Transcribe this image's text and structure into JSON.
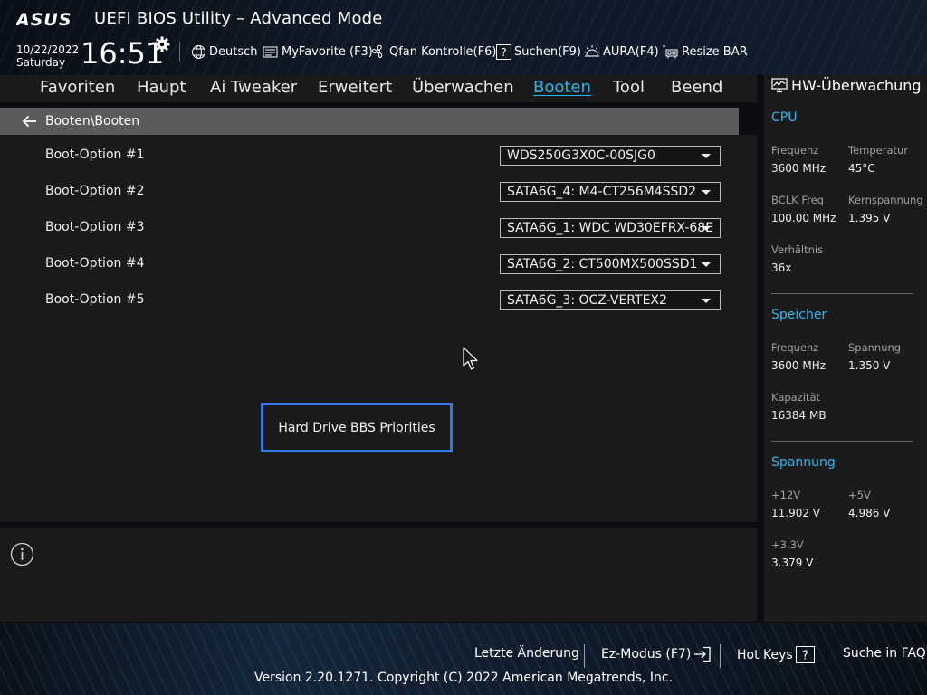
{
  "header": {
    "brand": "ASUS",
    "title": "UEFI BIOS Utility – Advanced Mode",
    "date": "10/22/2022",
    "day": "Saturday",
    "time": "16:51",
    "toolbar": [
      {
        "icon": "globe-icon",
        "label": "Deutsch"
      },
      {
        "icon": "myfavorite-icon",
        "label": "MyFavorite (F3)"
      },
      {
        "icon": "fan-icon",
        "label": "Qfan Kontrolle(F6)"
      },
      {
        "icon": "question-box-icon",
        "label": "Suchen(F9)"
      },
      {
        "icon": "aura-icon",
        "label": "AURA(F4)"
      },
      {
        "icon": "resize-bar-icon",
        "label": "Resize BAR"
      }
    ]
  },
  "nav": {
    "tabs": [
      "Favoriten",
      "Haupt",
      "Ai Tweaker",
      "Erweitert",
      "Überwachen",
      "Booten",
      "Tool",
      "Beend"
    ],
    "active": "Booten"
  },
  "breadcrumb": "Booten\\Booten",
  "boot_options": [
    {
      "label": "Boot-Option #1",
      "value": "WDS250G3X0C-00SJG0"
    },
    {
      "label": "Boot-Option #2",
      "value": "SATA6G_4: M4-CT256M4SSD2"
    },
    {
      "label": "Boot-Option #3",
      "value": "SATA6G_1: WDC WD30EFRX-68E"
    },
    {
      "label": "Boot-Option #4",
      "value": "SATA6G_2: CT500MX500SSD1"
    },
    {
      "label": "Boot-Option #5",
      "value": "SATA6G_3: OCZ-VERTEX2"
    }
  ],
  "bbs_button": "Hard Drive BBS Priorities",
  "hw_monitor": {
    "title": "HW-Überwachung",
    "cpu": {
      "title": "CPU",
      "freq_label": "Frequenz",
      "freq": "3600 MHz",
      "temp_label": "Temperatur",
      "temp": "45°C",
      "bclk_label": "BCLK Freq",
      "bclk": "100.00 MHz",
      "core_v_label": "Kernspannung",
      "core_v": "1.395 V",
      "ratio_label": "Verhältnis",
      "ratio": "36x"
    },
    "memory": {
      "title": "Speicher",
      "freq_label": "Frequenz",
      "freq": "3600 MHz",
      "volt_label": "Spannung",
      "volt": "1.350 V",
      "cap_label": "Kapazität",
      "cap": "16384 MB"
    },
    "voltage": {
      "title": "Spannung",
      "v12_label": "+12V",
      "v12": "11.902 V",
      "v5_label": "+5V",
      "v5": "4.986 V",
      "v33_label": "+3.3V",
      "v33": "3.379 V"
    }
  },
  "footer": {
    "last_change": "Letzte Änderung",
    "ez_mode": "Ez-Modus (F7)",
    "hot_keys": "Hot Keys",
    "faq": "Suche in FAQ",
    "copyright": "Version 2.20.1271. Copyright (C) 2022 American Megatrends, Inc."
  },
  "colors": {
    "accent": "#25b7f0",
    "focus_border": "#2f7ae5",
    "panel": "#1a1a1a"
  }
}
